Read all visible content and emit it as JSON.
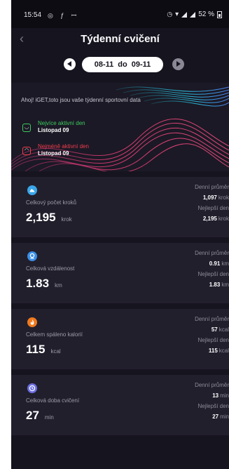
{
  "status_bar": {
    "time": "15:54",
    "battery": "52 %"
  },
  "header": {
    "title": "Týdenní cvičení"
  },
  "range": {
    "from": "08-11",
    "sep": "do",
    "to": "09-11"
  },
  "banner": {
    "greeting": "Ahoj! iGET,toto jsou vaše týdenní sportovní data",
    "most_active": {
      "label": "Nejvíce aktivní den",
      "date": "Listopad 09",
      "color": "#3ecb5f"
    },
    "least_active": {
      "label": "Nejméně aktivní den",
      "date": "Listopad 09",
      "color": "#f03c4c"
    }
  },
  "cards": [
    {
      "icon": "shoe-icon",
      "icon_color": "#3aa6e8",
      "label": "Celkový počet kroků",
      "value": "2,195",
      "unit": "krok",
      "avg_label": "Denní průměr",
      "avg_value": "1,097",
      "avg_unit": "krok",
      "best_label": "Nejlepší den",
      "best_value": "2,195",
      "best_unit": "krok"
    },
    {
      "icon": "location-pin-icon",
      "icon_color": "#3a8ee8",
      "label": "Celková vzdálenost",
      "value": "1.83",
      "unit": "km",
      "avg_label": "Denní průměr",
      "avg_value": "0.91",
      "avg_unit": "km",
      "best_label": "Nejlepší den",
      "best_value": "1.83",
      "best_unit": "km"
    },
    {
      "icon": "flame-icon",
      "icon_color": "#f07a1e",
      "label": "Celkem spáleno kalorií",
      "value": "115",
      "unit": "kcal",
      "avg_label": "Denní průměr",
      "avg_value": "57",
      "avg_unit": "kcal",
      "best_label": "Nejlepší den",
      "best_value": "115",
      "best_unit": "kcal"
    },
    {
      "icon": "clock-icon",
      "icon_color": "#6a6ee0",
      "label": "Celková doba cvičení",
      "value": "27",
      "unit": "min",
      "avg_label": "Denní průměr",
      "avg_value": "13",
      "avg_unit": "min",
      "best_label": "Nejlepší den",
      "best_value": "27",
      "best_unit": "min"
    }
  ]
}
